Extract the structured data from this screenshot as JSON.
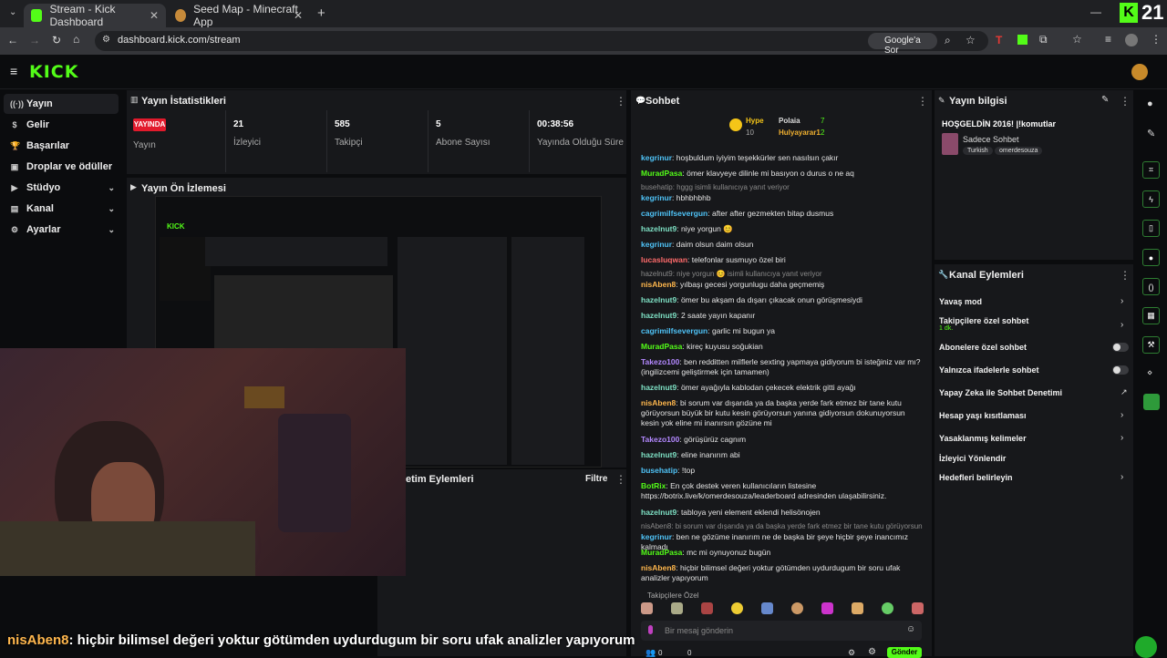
{
  "browser": {
    "tabs": [
      {
        "title": "Stream - Kick Dashboard",
        "active": true,
        "favicon_color": "#53fc18"
      },
      {
        "title": "Seed Map - Minecraft App",
        "active": false,
        "favicon_color": "#c68a3a"
      }
    ],
    "new_tab": "+",
    "url": "dashboard.kick.com/stream",
    "google_sor": "Google'a Sor",
    "corner_number": "21"
  },
  "app": {
    "logo": "KICK",
    "accent": "#53fc18"
  },
  "sidebar": {
    "items": [
      {
        "label": "Yayın",
        "icon": "signal-icon",
        "active": true,
        "chevron": false
      },
      {
        "label": "Gelir",
        "icon": "dollar-icon",
        "active": false,
        "chevron": false
      },
      {
        "label": "Başarılar",
        "icon": "trophy-icon",
        "active": false,
        "chevron": false
      },
      {
        "label": "Droplar ve ödüller",
        "icon": "gift-icon",
        "active": false,
        "chevron": false
      },
      {
        "label": "Stüdyo",
        "icon": "studio-icon",
        "active": false,
        "chevron": true
      },
      {
        "label": "Kanal",
        "icon": "channel-icon",
        "active": false,
        "chevron": true
      },
      {
        "label": "Ayarlar",
        "icon": "gear-icon",
        "active": false,
        "chevron": true
      }
    ]
  },
  "stats": {
    "title": "Yayın İstatistikleri",
    "live_badge": "YAYINDA",
    "live_label": "Yayın",
    "items": [
      {
        "value": "21",
        "label": "İzleyici"
      },
      {
        "value": "585",
        "label": "Takipçi"
      },
      {
        "value": "5",
        "label": "Abone Sayısı"
      },
      {
        "value": "00:38:56",
        "label": "Yayında Olduğu Süre"
      }
    ]
  },
  "preview": {
    "title": "Yayın Ön İzlemesi"
  },
  "actions_panel": {
    "title": "etim Eylemleri",
    "filter": "Filtre"
  },
  "chat": {
    "title": "Sohbet",
    "top_gifters": [
      {
        "name": "Hype",
        "count": "7"
      },
      {
        "name": "Polaia",
        "count": ""
      },
      {
        "name": "Hulyayarar1",
        "count": "2"
      }
    ],
    "hype_count": "10",
    "messages": [
      {
        "user": "kegrinur",
        "color": "#4fc3f7",
        "text": "hoşbuldum iyiyim teşekkürler sen nasılsın çakır"
      },
      {
        "user": "MuradPasa",
        "color": "#53fc18",
        "text": "ömer klavyeye dilinle mi basıyon o durus o ne aq"
      },
      {
        "reply": "busehatip: hggg isimli kullanıcıya yanıt veriyor"
      },
      {
        "user": "kegrinur",
        "color": "#4fc3f7",
        "text": "hbhbhbhb"
      },
      {
        "user": "cagrimilfsevergun",
        "color": "#4fc3f7",
        "text": "after after gezmekten bitap dusmus"
      },
      {
        "user": "hazelnut9",
        "color": "#7ee0c4",
        "text": "niye yorgun 😊"
      },
      {
        "user": "kegrinur",
        "color": "#4fc3f7",
        "text": "daim olsun daim olsun"
      },
      {
        "user": "lucasluqwan",
        "color": "#ff6b6b",
        "text": "telefonlar susmuyo özel biri"
      },
      {
        "reply": "hazelnut9: niye yorgun 😊 isimli kullanıcıya yanıt veriyor"
      },
      {
        "user": "nisAben8",
        "color": "#ffb74d",
        "text": "yılbaşı gecesi yorgunlugu daha geçmemiş"
      },
      {
        "user": "hazelnut9",
        "color": "#7ee0c4",
        "text": "ömer bu akşam da dışarı çıkacak onun görüşmesiydi"
      },
      {
        "user": "hazelnut9",
        "color": "#7ee0c4",
        "text": "2 saate yayın kapanır"
      },
      {
        "user": "cagrimilfsevergun",
        "color": "#4fc3f7",
        "text": "garlic mi bugun ya"
      },
      {
        "user": "MuradPasa",
        "color": "#53fc18",
        "text": "kireç kuyusu soğukian"
      },
      {
        "user": "Takezo100",
        "color": "#b388ff",
        "text": "ben redditten milflerle sexting yapmaya gidiyorum bi isteğiniz var mı?(ingilizcemi geliştirmek için tamamen)"
      },
      {
        "user": "hazelnut9",
        "color": "#7ee0c4",
        "text": "ömer ayağıyla kablodan çekecek elektrik gitti ayağı"
      },
      {
        "user": "nisAben8",
        "color": "#ffb74d",
        "text": "bi sorum var dışarıda ya da başka yerde fark etmez bir tane kutu görüyorsun büyük bir kutu kesin görüyorsun yanına gidiyorsun dokunuyorsun kesin yok eline mi inanırsın gözüne mi"
      },
      {
        "user": "Takezo100",
        "color": "#b388ff",
        "text": "görüşürüz cagnım"
      },
      {
        "user": "hazelnut9",
        "color": "#7ee0c4",
        "text": "eline inanırım abi"
      },
      {
        "user": "busehatip",
        "color": "#4fc3f7",
        "text": "!top"
      },
      {
        "user": "BotRix",
        "color": "#53fc18",
        "text": "En çok destek veren kullanıcıların listesine https://botrix.live/k/omerdesouza/leaderboard adresinden ulaşabilirsiniz."
      },
      {
        "user": "hazelnut9",
        "color": "#7ee0c4",
        "text": "tabloya yeni element eklendi helisönojen"
      },
      {
        "reply": "nisAben8: bi sorum var dışarıda ya da başka yerde fark etmez bir tane kutu görüyorsun büyük b..."
      },
      {
        "user": "kegrinur",
        "color": "#4fc3f7",
        "text": "ben ne gözüme inanırım ne de başka bir şeye hiçbir şeye inancımız kalmadı"
      },
      {
        "user": "MuradPasa",
        "color": "#53fc18",
        "text": "mc mi oynuyonuz bugün"
      },
      {
        "user": "nisAben8",
        "color": "#ffb74d",
        "text": "hiçbir bilimsel değeri yoktur götümden uydurdugum bir soru ufak analizler yapıyorum"
      }
    ],
    "followers_only": "Takipçilere Özel",
    "input_placeholder": "Bir mesaj gönderin",
    "send": "Gönder",
    "counts": [
      "0",
      "0"
    ]
  },
  "stream_info": {
    "title": "Yayın bilgisi",
    "stream_title": "HOŞGELDİN 2016! |!komutlar",
    "category": "Sadece Sohbet",
    "tags": [
      "Turkish",
      "omerdesouza"
    ]
  },
  "channel_actions": {
    "title": "Kanal Eylemleri",
    "items": [
      {
        "label": "Yavaş mod",
        "type": "chevron"
      },
      {
        "label": "Takipçilere özel sohbet",
        "sub": "1 dk.",
        "type": "chevron"
      },
      {
        "label": "Abonelere özel sohbet",
        "type": "toggle"
      },
      {
        "label": "Yalnızca ifadelerle sohbet",
        "type": "toggle"
      },
      {
        "label": "Yapay Zeka ile Sohbet Denetimi",
        "type": "external"
      },
      {
        "label": "Hesap yaşı kısıtlaması",
        "type": "chevron"
      },
      {
        "label": "Yasaklanmış kelimeler",
        "type": "chevron"
      },
      {
        "label": "İzleyici Yönlendir",
        "type": "none"
      },
      {
        "label": "Hedefleri belirleyin",
        "type": "chevron"
      }
    ]
  },
  "caption": {
    "user": "nisAben8",
    "text": ": hiçbir bilimsel değeri yoktur götümden uydurdugum bir soru ufak analizler yapıyorum"
  }
}
